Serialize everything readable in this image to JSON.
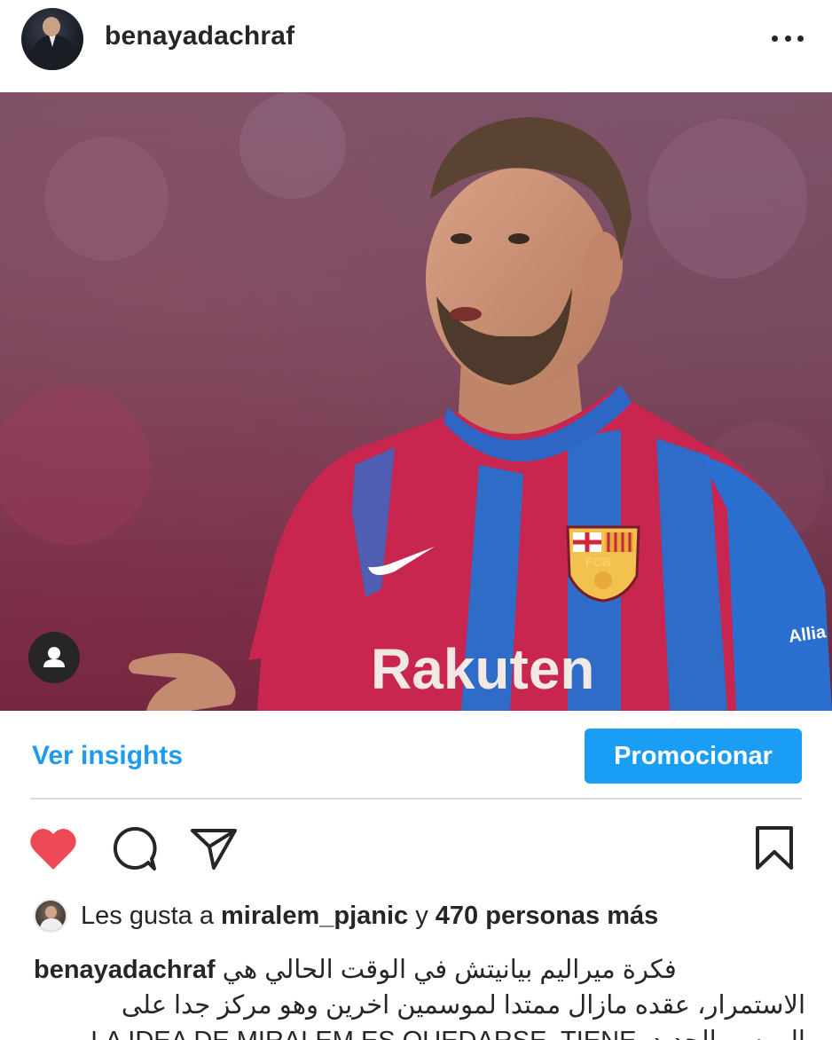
{
  "post": {
    "username": "benayadachraf",
    "more_icon": "more-horizontal-icon"
  },
  "photo": {
    "jersey_sponsor": "Rakuten",
    "crest_text": "FCB",
    "sleeve_text": "Allia",
    "user_tag_icon": "person-icon"
  },
  "insights": {
    "link_label": "Ver insights",
    "promote_label": "Promocionar"
  },
  "actions": {
    "like_icon": "heart-filled-icon",
    "comment_icon": "comment-icon",
    "share_icon": "send-icon",
    "save_icon": "bookmark-icon",
    "like_color": "#ed4956"
  },
  "likes": {
    "prefix": "Les gusta a ",
    "user": "miralem_pjanic",
    "middle": " y ",
    "count_text": "470 personas más"
  },
  "caption": {
    "author": "benayadachraf",
    "line1": "فكرة ميراليم بيانيتش في الوقت الحالي هي",
    "line2": "الاستمرار، عقده مازال ممتدا لموسمين اخرين وهو مركز جدا على",
    "line3": "الموسم الجديد. LA IDEA DE MIRALEM ES QUEDARSE. TIENE"
  },
  "colors": {
    "accent": "#1a9df5",
    "link": "#1d9bf0",
    "text": "#262626"
  }
}
